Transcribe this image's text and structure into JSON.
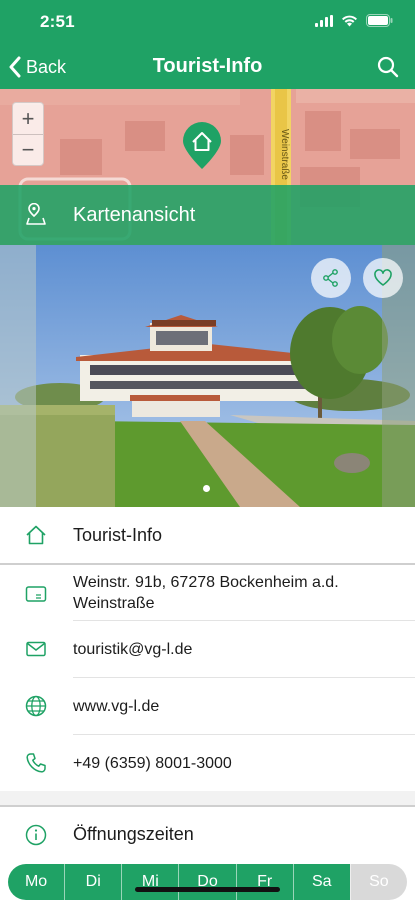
{
  "status_bar": {
    "time": "2:51"
  },
  "nav": {
    "back_label": "Back",
    "title": "Tourist-Info"
  },
  "map": {
    "street_label": "Weinstraße",
    "view_label": "Kartenansicht",
    "zoom_in": "+",
    "zoom_out": "−"
  },
  "info": {
    "name": "Tourist-Info",
    "address": "Weinstr. 91b, 67278 Bockenheim a.d. Weinstraße",
    "email": "touristik@vg-l.de",
    "website": "www.vg-l.de",
    "phone": "+49 (6359) 8001-3000",
    "hours_label": "Öffnungszeiten"
  },
  "weekdays": [
    {
      "label": "Mo",
      "open": true
    },
    {
      "label": "Di",
      "open": true
    },
    {
      "label": "Mi",
      "open": true
    },
    {
      "label": "Do",
      "open": true
    },
    {
      "label": "Fr",
      "open": true
    },
    {
      "label": "Sa",
      "open": true
    },
    {
      "label": "So",
      "open": false
    }
  ],
  "colors": {
    "accent": "#1fa265",
    "map_base": "#e7a49a",
    "closed_day": "#d9d9d9"
  },
  "icons": {
    "back": "chevron-left-icon",
    "search": "search-icon",
    "pin": "home-pin-icon",
    "map_view": "map-location-icon",
    "share": "share-icon",
    "favorite": "heart-icon",
    "name": "home-icon",
    "address": "address-card-icon",
    "email": "mail-icon",
    "website": "globe-icon",
    "phone": "phone-icon",
    "hours": "info-icon"
  },
  "photo": {
    "page_index": 1,
    "page_count": 1
  }
}
